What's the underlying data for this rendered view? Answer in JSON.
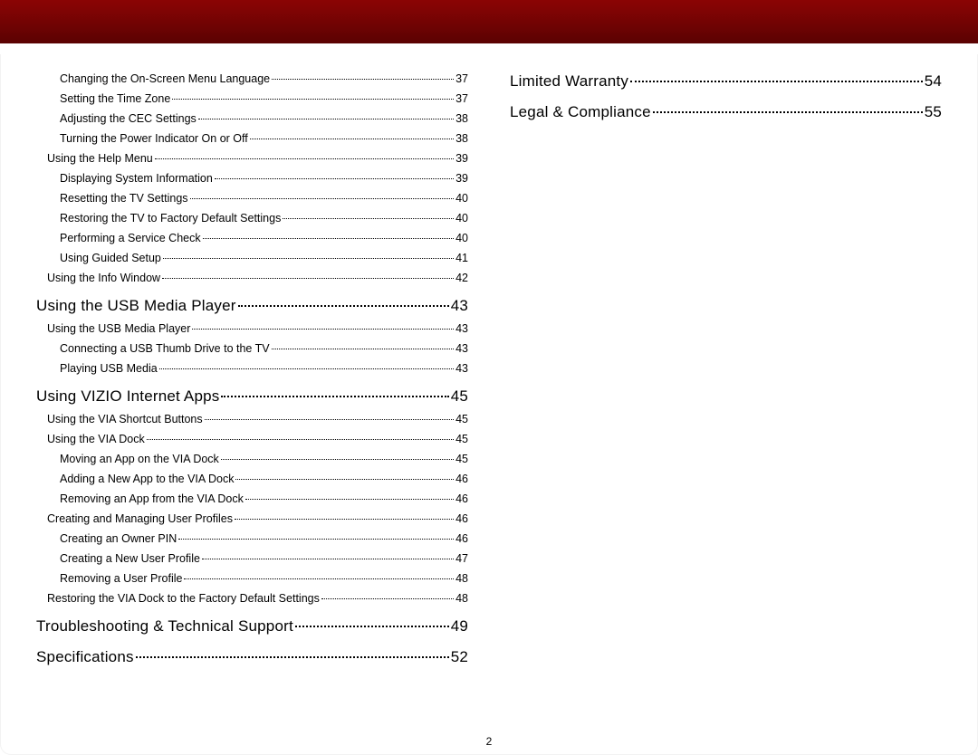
{
  "page_number": "2",
  "columns": [
    [
      {
        "level": 2,
        "label": "Changing the On-Screen Menu Language",
        "page": "37",
        "firstInCol": true
      },
      {
        "level": 2,
        "label": "Setting the Time Zone",
        "page": "37"
      },
      {
        "level": 2,
        "label": "Adjusting the CEC Settings",
        "page": "38"
      },
      {
        "level": 2,
        "label": "Turning the Power Indicator On or Off",
        "page": "38"
      },
      {
        "level": 1,
        "label": "Using the Help Menu",
        "page": "39"
      },
      {
        "level": 2,
        "label": "Displaying System Information",
        "page": "39"
      },
      {
        "level": 2,
        "label": "Resetting the TV Settings",
        "page": "40"
      },
      {
        "level": 2,
        "label": "Restoring the TV to Factory Default Settings",
        "page": "40"
      },
      {
        "level": 2,
        "label": "Performing a Service Check",
        "page": "40"
      },
      {
        "level": 2,
        "label": "Using Guided Setup",
        "page": "41"
      },
      {
        "level": 1,
        "label": "Using the Info Window",
        "page": "42"
      },
      {
        "level": 0,
        "label": "Using the USB Media Player",
        "page": "43"
      },
      {
        "level": 1,
        "label": "Using the USB Media Player",
        "page": "43"
      },
      {
        "level": 2,
        "label": "Connecting a USB Thumb Drive to the TV",
        "page": "43"
      },
      {
        "level": 2,
        "label": "Playing USB Media",
        "page": "43"
      },
      {
        "level": 0,
        "label": "Using VIZIO Internet Apps",
        "page": "45"
      },
      {
        "level": 1,
        "label": "Using the VIA Shortcut Buttons",
        "page": "45"
      },
      {
        "level": 1,
        "label": "Using the VIA Dock",
        "page": "45"
      },
      {
        "level": 2,
        "label": "Moving an App on the VIA Dock",
        "page": "45"
      },
      {
        "level": 2,
        "label": "Adding a New App to the VIA Dock",
        "page": "46"
      },
      {
        "level": 2,
        "label": "Removing an App from the VIA Dock",
        "page": "46"
      },
      {
        "level": 1,
        "label": "Creating and Managing User Profiles",
        "page": "46"
      },
      {
        "level": 2,
        "label": "Creating an Owner PIN",
        "page": "46"
      },
      {
        "level": 2,
        "label": "Creating a New User Profile",
        "page": "47"
      },
      {
        "level": 2,
        "label": "Removing a User Profile",
        "page": "48"
      },
      {
        "level": 1,
        "label": "Restoring the VIA Dock to the Factory Default Settings",
        "page": "48"
      },
      {
        "level": 0,
        "label": "Troubleshooting & Technical Support",
        "page": "49"
      },
      {
        "level": 0,
        "label": "Specifications",
        "page": "52"
      }
    ],
    [
      {
        "level": 0,
        "label": "Limited Warranty",
        "page": "54",
        "firstInCol": true
      },
      {
        "level": 0,
        "label": "Legal & Compliance",
        "page": "55"
      }
    ]
  ]
}
